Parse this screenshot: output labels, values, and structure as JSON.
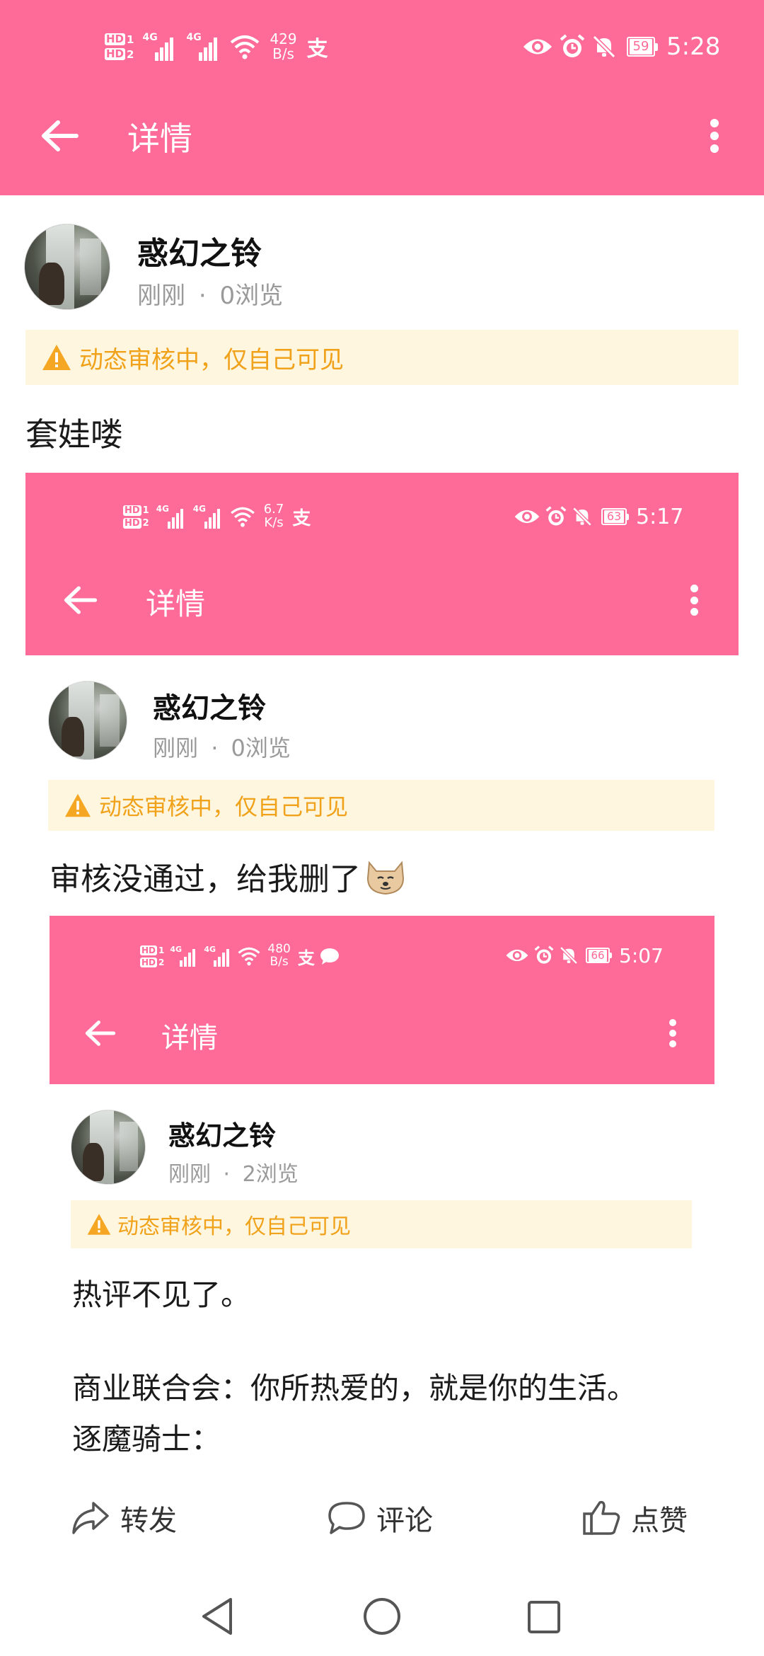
{
  "status_bar": {
    "speed_value": "429",
    "speed_unit": "B/s",
    "battery": "59",
    "time": "5:28",
    "hd1": "HD",
    "hd2": "HD",
    "sim1": "1",
    "sim2": "2",
    "network": "4G",
    "alipay_icon": "支"
  },
  "header": {
    "title": "详情"
  },
  "post": {
    "author": "惑幻之铃",
    "time": "刚刚",
    "separator": "·",
    "views": "0浏览",
    "notice": "动态审核中，仅自己可见",
    "text": "套娃喽"
  },
  "embed1": {
    "status_bar": {
      "speed_value": "6.7",
      "speed_unit": "K/s",
      "battery": "63",
      "time": "5:17"
    },
    "header": {
      "title": "详情"
    },
    "post": {
      "author": "惑幻之铃",
      "time": "刚刚",
      "separator": "·",
      "views": "0浏览",
      "notice": "动态审核中，仅自己可见",
      "text": "审核没通过，给我删了"
    }
  },
  "embed2": {
    "status_bar": {
      "speed_value": "480",
      "speed_unit": "B/s",
      "battery": "66",
      "time": "5:07"
    },
    "header": {
      "title": "详情"
    },
    "post": {
      "author": "惑幻之铃",
      "time": "刚刚",
      "separator": "·",
      "views": "2浏览",
      "notice": "动态审核中，仅自己可见",
      "line1": "热评不见了。",
      "line2": "商业联合会：你所热爱的，就是你的生活。",
      "line3": "逐魔骑士："
    }
  },
  "actions": {
    "share": "转发",
    "comment": "评论",
    "like": "点赞"
  },
  "colors": {
    "brand_pink": "#fe6b98",
    "notice_bg": "#fff6e0",
    "notice_text": "#f0a21a"
  }
}
